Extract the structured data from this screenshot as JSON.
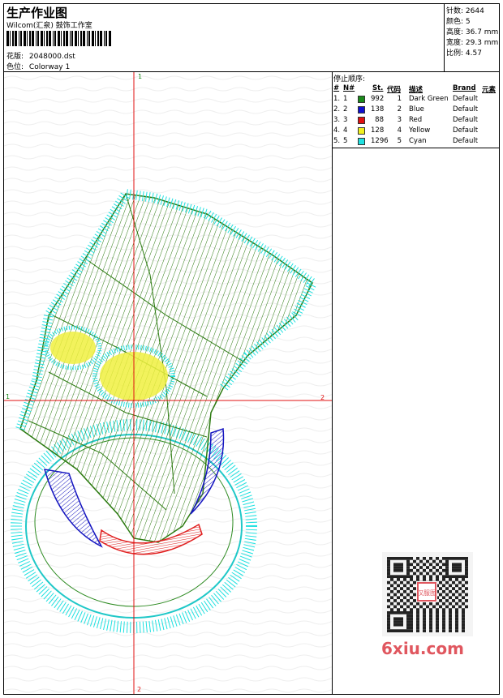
{
  "header": {
    "title": "生产作业图",
    "company": "Wilcom(汇泉) 鼓饰工作室",
    "design_label": "花版:",
    "design_value": "2048000.dst",
    "colorway_label": "色位:",
    "colorway_value": "Colorway 1"
  },
  "stats": {
    "stitches": "针数: 2644",
    "colors": "颜色: 5",
    "height": "高度: 36.7 mm",
    "width": "宽度: 29.3 mm",
    "ratio": "比例: 4.57"
  },
  "stop_sequence": {
    "title": "停止顺序:",
    "columns": [
      "#",
      "N#",
      "St.",
      "代码",
      "描述",
      "Brand",
      "元素"
    ],
    "rows": [
      {
        "num": "1.",
        "n": "1",
        "color": "#1a8a1a",
        "st": "992",
        "code": "1",
        "desc": "Dark Green",
        "brand": "Default"
      },
      {
        "num": "2.",
        "n": "2",
        "color": "#1010d0",
        "st": "138",
        "code": "2",
        "desc": "Blue",
        "brand": "Default"
      },
      {
        "num": "3.",
        "n": "3",
        "color": "#e01010",
        "st": "88",
        "code": "3",
        "desc": "Red",
        "brand": "Default"
      },
      {
        "num": "4.",
        "n": "4",
        "color": "#f0f020",
        "st": "128",
        "code": "4",
        "desc": "Yellow",
        "brand": "Default"
      },
      {
        "num": "5.",
        "n": "5",
        "color": "#20e0e0",
        "st": "1296",
        "code": "5",
        "desc": "Cyan",
        "brand": "Default"
      }
    ]
  },
  "axes": {
    "top": "1",
    "left": "1",
    "right": "2",
    "bottom": "2"
  },
  "watermark": {
    "site": "6xiu.com",
    "stamp": "汉服图"
  }
}
